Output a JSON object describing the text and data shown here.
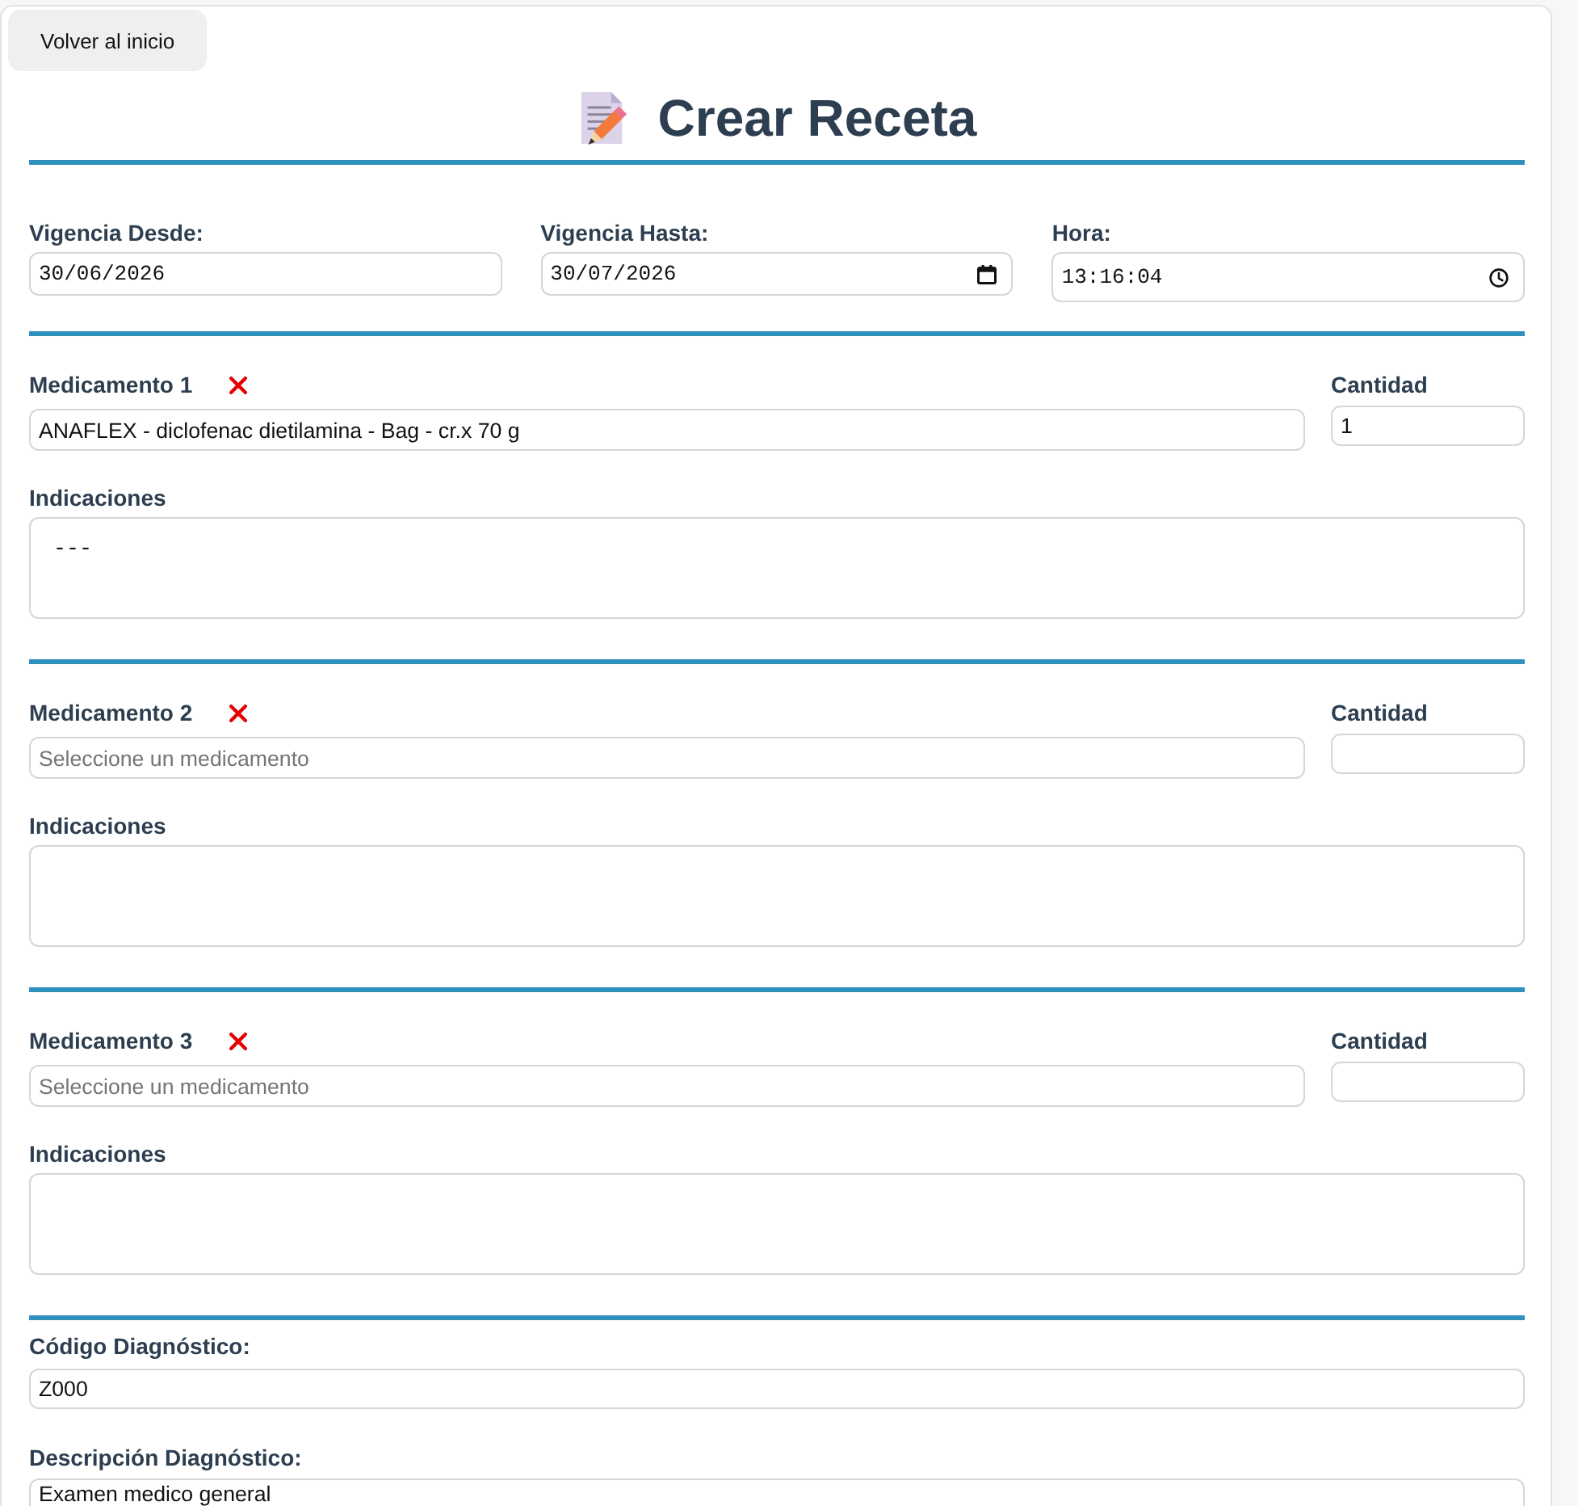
{
  "back_button": {
    "label": "Volver al inicio"
  },
  "title": "Crear Receta",
  "validity": [
    {
      "label": "Vigencia Desde:",
      "value": "30/06/2026",
      "kind": "text"
    },
    {
      "label": "Vigencia Hasta:",
      "value": "30/07/2026",
      "kind": "date"
    },
    {
      "label": "Hora:",
      "value": "13:16:04",
      "kind": "time"
    }
  ],
  "medications": [
    {
      "label": "Medicamento 1",
      "medication": {
        "value": "ANAFLEX - diclofenac dietilamina - Bag - cr.x 70 g"
      },
      "quantity": {
        "label": "Cantidad",
        "value": "1"
      },
      "indications": {
        "label": "Indicaciones",
        "value": "---"
      }
    },
    {
      "label": "Medicamento 2",
      "medication": {
        "placeholder": "Seleccione un medicamento"
      },
      "quantity": {
        "label": "Cantidad"
      },
      "indications": {
        "label": "Indicaciones"
      }
    },
    {
      "label": "Medicamento 3",
      "medication": {
        "placeholder": "Seleccione un medicamento"
      },
      "quantity": {
        "label": "Cantidad"
      },
      "indications": {
        "label": "Indicaciones"
      }
    }
  ],
  "diagnosis": [
    {
      "label": "Código Diagnóstico:",
      "value": "Z000"
    },
    {
      "label": "Descripción Diagnóstico:",
      "value": "Examen medico general"
    }
  ]
}
